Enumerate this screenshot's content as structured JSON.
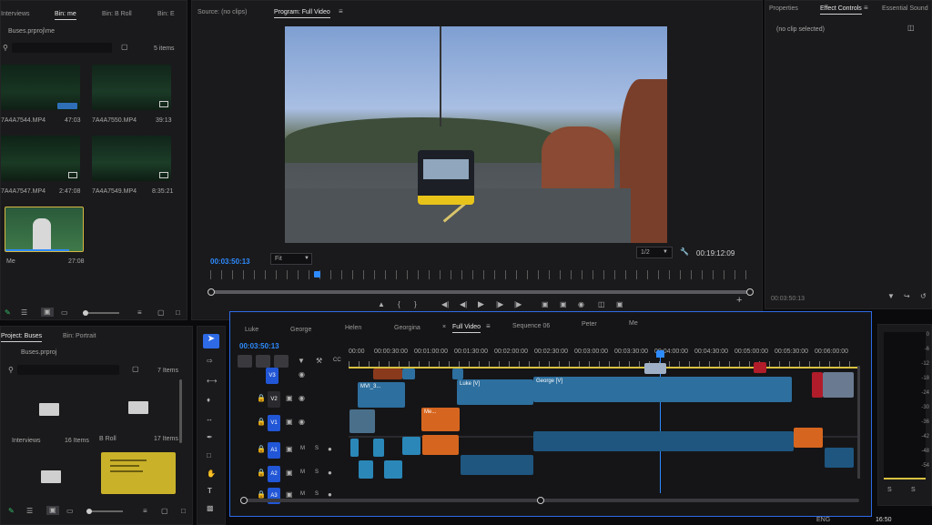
{
  "project_panel": {
    "tabs": [
      "Interviews",
      "Bin: me",
      "Bin: B Roll",
      "Bin: E"
    ],
    "active_tab": 1,
    "path": "Buses.prproj\\me",
    "item_count": "5 items",
    "clips": [
      {
        "name": "7A4A7544.MP4",
        "duration": "47:03"
      },
      {
        "name": "7A4A7550.MP4",
        "duration": "39:13"
      },
      {
        "name": "7A4A7547.MP4",
        "duration": "2:47:08"
      },
      {
        "name": "7A4A7549.MP4",
        "duration": "8:35:21"
      },
      {
        "name": "Me",
        "duration": "27:08"
      }
    ]
  },
  "bottom_project": {
    "tabs": [
      "Project: Buses",
      "Bin: Portrait"
    ],
    "path": "Buses.prproj",
    "item_count": "7 Items",
    "bins": [
      {
        "name": "Interviews",
        "count": "16 Items"
      },
      {
        "name": "B Roll",
        "count": "17 Items"
      }
    ]
  },
  "source_tab": "Source: (no clips)",
  "program_tab": "Program: Full Video",
  "program": {
    "timecode": "00:03:50:13",
    "fit": "Fit",
    "resolution": "1/2",
    "duration": "00:19:12:09"
  },
  "effect_controls": {
    "tabs": [
      "Properties",
      "Effect Controls",
      "Essential Sound"
    ],
    "message": "(no clip selected)",
    "timecode": "00:03:50:13"
  },
  "timeline": {
    "sequence_tabs": [
      "Luke",
      "George",
      "Helen",
      "Georgina",
      "Full Video",
      "Sequence 06",
      "Peter",
      "Me"
    ],
    "active_tab": 4,
    "timecode": "00:03:50:13",
    "ruler": [
      "00:00",
      "00:00:30:00",
      "00:01:00:00",
      "00:01:30:00",
      "00:02:00:00",
      "00:02:30:00",
      "00:03:00:00",
      "00:03:30:00",
      "00:04:00:00",
      "00:04:30:00",
      "00:05:00:00",
      "00:05:30:00",
      "00:06:00:00"
    ],
    "tracks": [
      "V3",
      "V2",
      "V1",
      "A1",
      "A2",
      "A3"
    ],
    "clip_labels": {
      "mvi": "MVI_3...",
      "fx": "fx",
      "luke": "Luke [V]",
      "george": "George [V]",
      "me": "Me..."
    }
  },
  "meter_scale": [
    "0",
    "-6",
    "-12",
    "-18",
    "-24",
    "-30",
    "-36",
    "-42",
    "-48",
    "-54"
  ],
  "meter_foot": [
    "S",
    "S"
  ],
  "taskbar": {
    "lang": "ENG",
    "time": "16:50"
  },
  "colors": {
    "accent": "#2e8bff",
    "track_blue": "#2156d6",
    "clip_blue": "#2d6f9f",
    "clip_orange": "#d6661f"
  }
}
